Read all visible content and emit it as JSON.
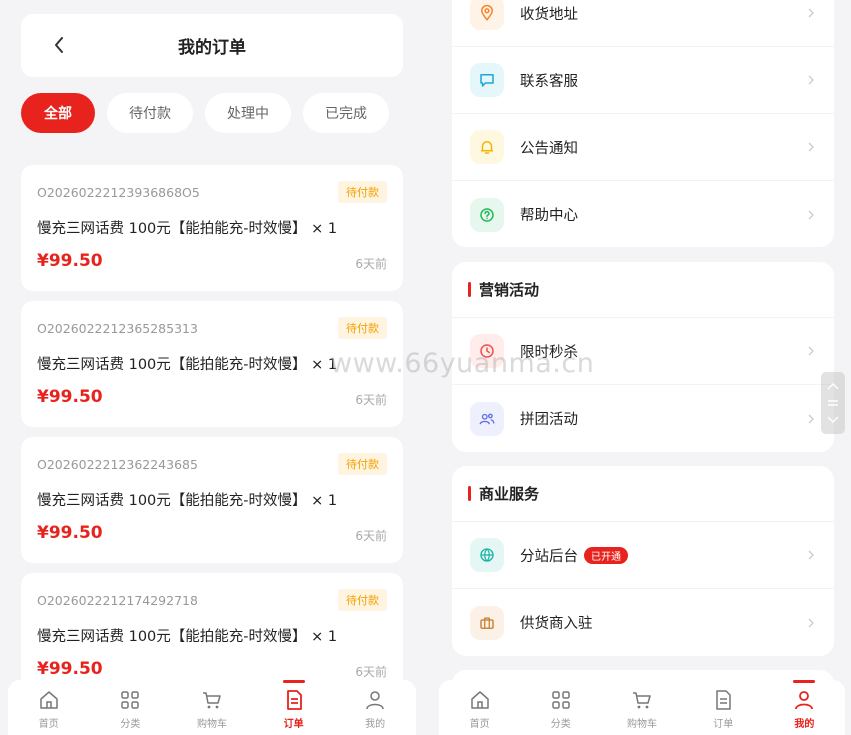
{
  "left": {
    "header": {
      "title": "我的订单"
    },
    "tabs": [
      {
        "label": "全部",
        "active": true
      },
      {
        "label": "待付款"
      },
      {
        "label": "处理中"
      },
      {
        "label": "已完成"
      }
    ],
    "orders": [
      {
        "order_no": "O20260222123936868O5",
        "status": "待付款",
        "product": "慢充三网话费 100元【能拍能充-时效慢】 × 1",
        "price": "¥99.50",
        "time": "6天前"
      },
      {
        "order_no": "O202602221236528531​3",
        "status": "待付款",
        "product": "慢充三网话费 100元【能拍能充-时效慢】 × 1",
        "price": "¥99.50",
        "time": "6天前"
      },
      {
        "order_no": "O20260222123622436​85",
        "status": "待付款",
        "product": "慢充三网话费 100元【能拍能充-时效慢】 × 1",
        "price": "¥99.50",
        "time": "6天前"
      },
      {
        "order_no": "O20260222121742927​18",
        "status": "待付款",
        "product": "慢充三网话费 100元【能拍能充-时效慢】 × 1",
        "price": "¥99.50",
        "time": "6天前"
      }
    ],
    "tabbar": [
      {
        "label": "首页",
        "icon": "home-icon"
      },
      {
        "label": "分类",
        "icon": "grid-icon"
      },
      {
        "label": "购物车",
        "icon": "cart-icon"
      },
      {
        "label": "订单",
        "icon": "order-icon",
        "active": true
      },
      {
        "label": "我的",
        "icon": "user-icon"
      }
    ]
  },
  "right": {
    "service_menu": [
      {
        "label": "收货地址",
        "icon": "location-icon",
        "color": "#f5862a",
        "bg": "#fff3e8"
      },
      {
        "label": "联系客服",
        "icon": "chat-icon",
        "color": "#1aa8d6",
        "bg": "#e6f7fc"
      },
      {
        "label": "公告通知",
        "icon": "bell-icon",
        "color": "#f5b400",
        "bg": "#fff8e0"
      },
      {
        "label": "帮助中心",
        "icon": "help-icon",
        "color": "#23b85b",
        "bg": "#e6f8ee"
      }
    ],
    "marketing": {
      "title": "营销活动",
      "items": [
        {
          "label": "限时秒杀",
          "icon": "clock-icon",
          "color": "#f0504a",
          "bg": "#ffeceb"
        },
        {
          "label": "拼团活动",
          "icon": "group-icon",
          "color": "#6272e6",
          "bg": "#eef0fd"
        }
      ]
    },
    "business": {
      "title": "商业服务",
      "items": [
        {
          "label": "分站后台",
          "icon": "globe-icon",
          "color": "#19b3a5",
          "bg": "#e4f7f5",
          "badge": "已开通"
        },
        {
          "label": "供货商入驻",
          "icon": "briefcase-icon",
          "color": "#c47a2c",
          "bg": "#fbf1e6"
        }
      ]
    },
    "tabbar": [
      {
        "label": "首页",
        "icon": "home-icon"
      },
      {
        "label": "分类",
        "icon": "grid-icon"
      },
      {
        "label": "购物车",
        "icon": "cart-icon"
      },
      {
        "label": "订单",
        "icon": "order-icon"
      },
      {
        "label": "我的",
        "icon": "user-icon",
        "active": true
      }
    ]
  },
  "watermark": "www.66yuanma.cn",
  "colors": {
    "accent": "#e8221c",
    "pending": "#f5a000"
  }
}
